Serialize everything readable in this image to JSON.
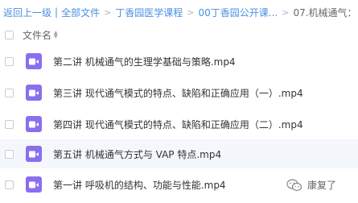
{
  "breadcrumb": {
    "back": "返回上一级",
    "all_files": "全部文件",
    "crumbs": [
      "丁香园医学课程",
      "00丁香园公开课...",
      "07.机械通气："
    ],
    "separator": ">"
  },
  "list_header": {
    "name_label": "文件名"
  },
  "files": [
    {
      "name": "第二讲 机械通气的生理学基础与策略.mp4",
      "icon": "video-file-icon"
    },
    {
      "name": "第三讲 现代通气模式的特点、缺陷和正确应用（一）.mp4",
      "icon": "video-file-icon"
    },
    {
      "name": "第四讲 现代通气模式的特点、缺陷和正确应用（二）.mp4",
      "icon": "video-file-icon"
    },
    {
      "name": "第五讲 机械通气方式与 VAP 特点.mp4",
      "icon": "video-file-icon"
    },
    {
      "name": "第一讲 呼吸机的结构、功能与性能.mp4",
      "icon": "video-file-icon"
    }
  ],
  "watermark": {
    "text": "康复了",
    "icon": "wechat-logo-icon"
  },
  "colors": {
    "link": "#4a90e2",
    "video_icon": "#8a6ef0",
    "row_hover": "#f4f7fc",
    "text": "#333333"
  }
}
